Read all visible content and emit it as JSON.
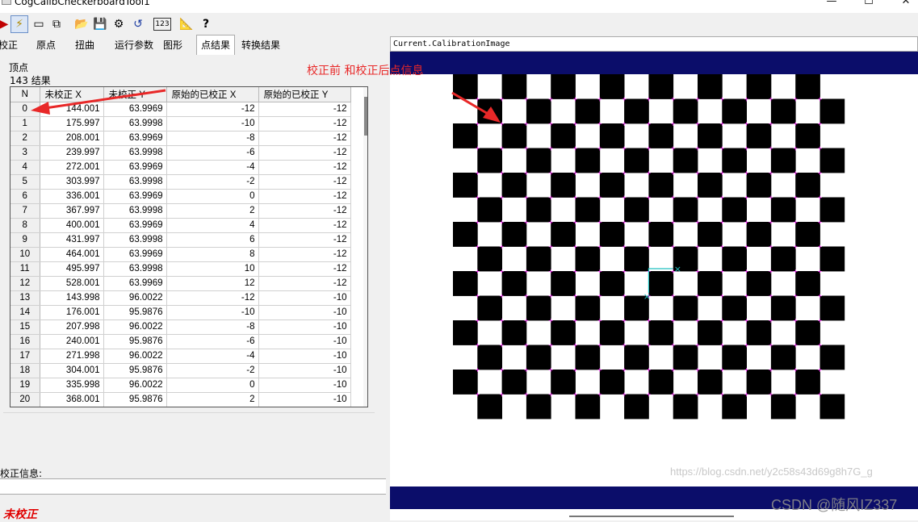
{
  "window": {
    "title": "CogCalibCheckerboardTool1",
    "minimize_glyph": "—",
    "maximize_glyph": "☐",
    "close_glyph": "✕"
  },
  "toolbar": {
    "icons": [
      "run-icon",
      "electric-icon",
      "camera-icon",
      "image-link-icon",
      "open-folder-icon",
      "save-icon",
      "tool-settings-icon",
      "reset-icon",
      "number-display-icon",
      "calibrate-icon",
      "help-icon"
    ],
    "glyphs": [
      "▶",
      "⚡",
      "▭",
      "⧉",
      "📂",
      "💾",
      "⚙",
      "↺",
      "123",
      "📐",
      "?"
    ],
    "active_index": 1
  },
  "tabs": [
    "校正",
    "原点",
    "扭曲",
    "运行参数",
    "图形",
    "点结果",
    "转换结果"
  ],
  "active_tab": "点结果",
  "points_panel": {
    "group_label": "顶点",
    "count_label": "143  结果",
    "columns": [
      "N",
      "未校正 X",
      "未校正 Y",
      "原始的已校正 X",
      "原始的已校正 Y"
    ],
    "rows": [
      [
        "0",
        "144.001",
        "63.9969",
        "-12",
        "-12"
      ],
      [
        "1",
        "175.997",
        "63.9998",
        "-10",
        "-12"
      ],
      [
        "2",
        "208.001",
        "63.9969",
        "-8",
        "-12"
      ],
      [
        "3",
        "239.997",
        "63.9998",
        "-6",
        "-12"
      ],
      [
        "4",
        "272.001",
        "63.9969",
        "-4",
        "-12"
      ],
      [
        "5",
        "303.997",
        "63.9998",
        "-2",
        "-12"
      ],
      [
        "6",
        "336.001",
        "63.9969",
        "0",
        "-12"
      ],
      [
        "7",
        "367.997",
        "63.9998",
        "2",
        "-12"
      ],
      [
        "8",
        "400.001",
        "63.9969",
        "4",
        "-12"
      ],
      [
        "9",
        "431.997",
        "63.9998",
        "6",
        "-12"
      ],
      [
        "10",
        "464.001",
        "63.9969",
        "8",
        "-12"
      ],
      [
        "11",
        "495.997",
        "63.9998",
        "10",
        "-12"
      ],
      [
        "12",
        "528.001",
        "63.9969",
        "12",
        "-12"
      ],
      [
        "13",
        "143.998",
        "96.0022",
        "-12",
        "-10"
      ],
      [
        "14",
        "176.001",
        "95.9876",
        "-10",
        "-10"
      ],
      [
        "15",
        "207.998",
        "96.0022",
        "-8",
        "-10"
      ],
      [
        "16",
        "240.001",
        "95.9876",
        "-6",
        "-10"
      ],
      [
        "17",
        "271.998",
        "96.0022",
        "-4",
        "-10"
      ],
      [
        "18",
        "304.001",
        "95.9876",
        "-2",
        "-10"
      ],
      [
        "19",
        "335.998",
        "96.0022",
        "0",
        "-10"
      ],
      [
        "20",
        "368.001",
        "95.9876",
        "2",
        "-10"
      ]
    ]
  },
  "calibration_info_label": "校正信息:",
  "calibration_info_value": "",
  "status_text": "未校正",
  "status_color": "#e00000",
  "display": {
    "header": "Current.CalibrationImage",
    "frame_color": "#0b0d6a",
    "marker_color": "#ff33ff",
    "origin_color": "#22c0c0",
    "origin_marker": "×"
  },
  "annotation": {
    "text": "校正前 和校正后点信息",
    "color": "#e82828"
  },
  "watermark": {
    "url": "https://blog.csdn.net/y2c58s43d69g8h7G_g",
    "credit": "CSDN @随风IZ337"
  }
}
